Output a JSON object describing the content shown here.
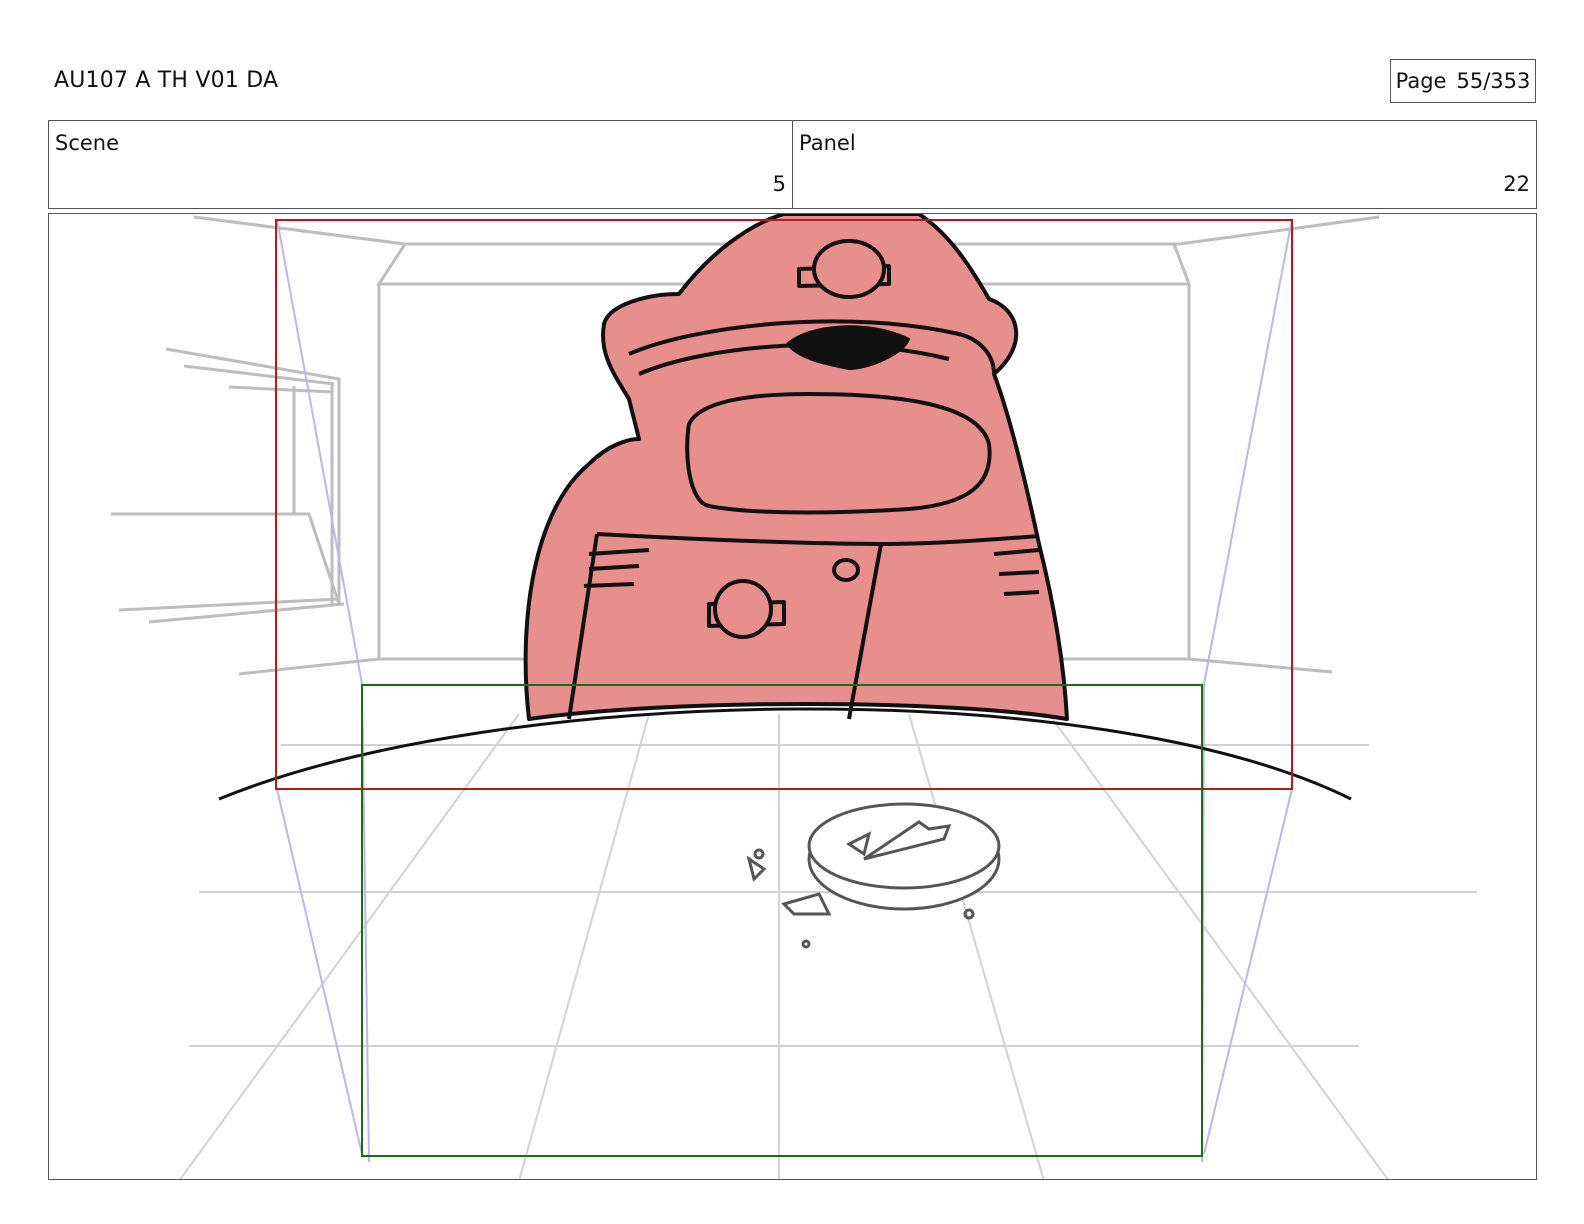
{
  "header": {
    "doc_id": "AU107 A TH V01 DA",
    "page_label": "Page",
    "page_value": "55/353"
  },
  "info": {
    "scene_label": "Scene",
    "scene_value": "5",
    "panel_label": "Panel",
    "panel_value": "22"
  },
  "artwork": {
    "description_icons": [
      "character-body",
      "visor",
      "backpack",
      "pizza-on-floor"
    ],
    "colors": {
      "character_fill": "#e78f8c",
      "safe_frame_red": "#b01c1c",
      "safe_frame_green": "#1b6b1b",
      "perspective_blue": "#b9b9e6",
      "sketch_gray": "#bdbdbd"
    }
  }
}
